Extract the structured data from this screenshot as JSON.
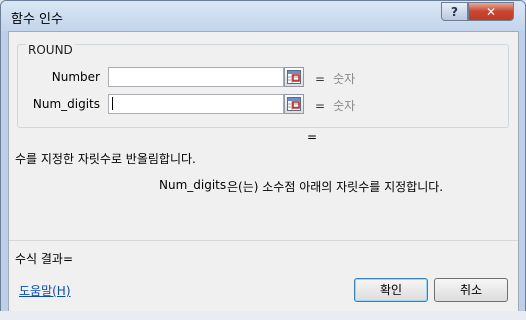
{
  "window": {
    "title": "함수 인수",
    "help_label": "?",
    "close_label": "✕"
  },
  "group": {
    "label": "ROUND"
  },
  "args": [
    {
      "label": "Number",
      "value": "",
      "eq": "=",
      "result": "숫자"
    },
    {
      "label": "Num_digits",
      "value": "",
      "eq": "=",
      "result": "숫자"
    }
  ],
  "formula_result": "=",
  "description": {
    "main": "수를 지정한 자릿수로 반올림합니다.",
    "arg_name": "Num_digits",
    "arg_text": "은(는) 소수점 아래의 자릿수를 지정합니다."
  },
  "result_label": "수식 결과=",
  "help_link": "도움말(H)",
  "buttons": {
    "ok": "확인",
    "cancel": "취소"
  },
  "icons": {
    "collapse": "range-select-icon",
    "help": "question-icon",
    "close": "close-icon"
  }
}
